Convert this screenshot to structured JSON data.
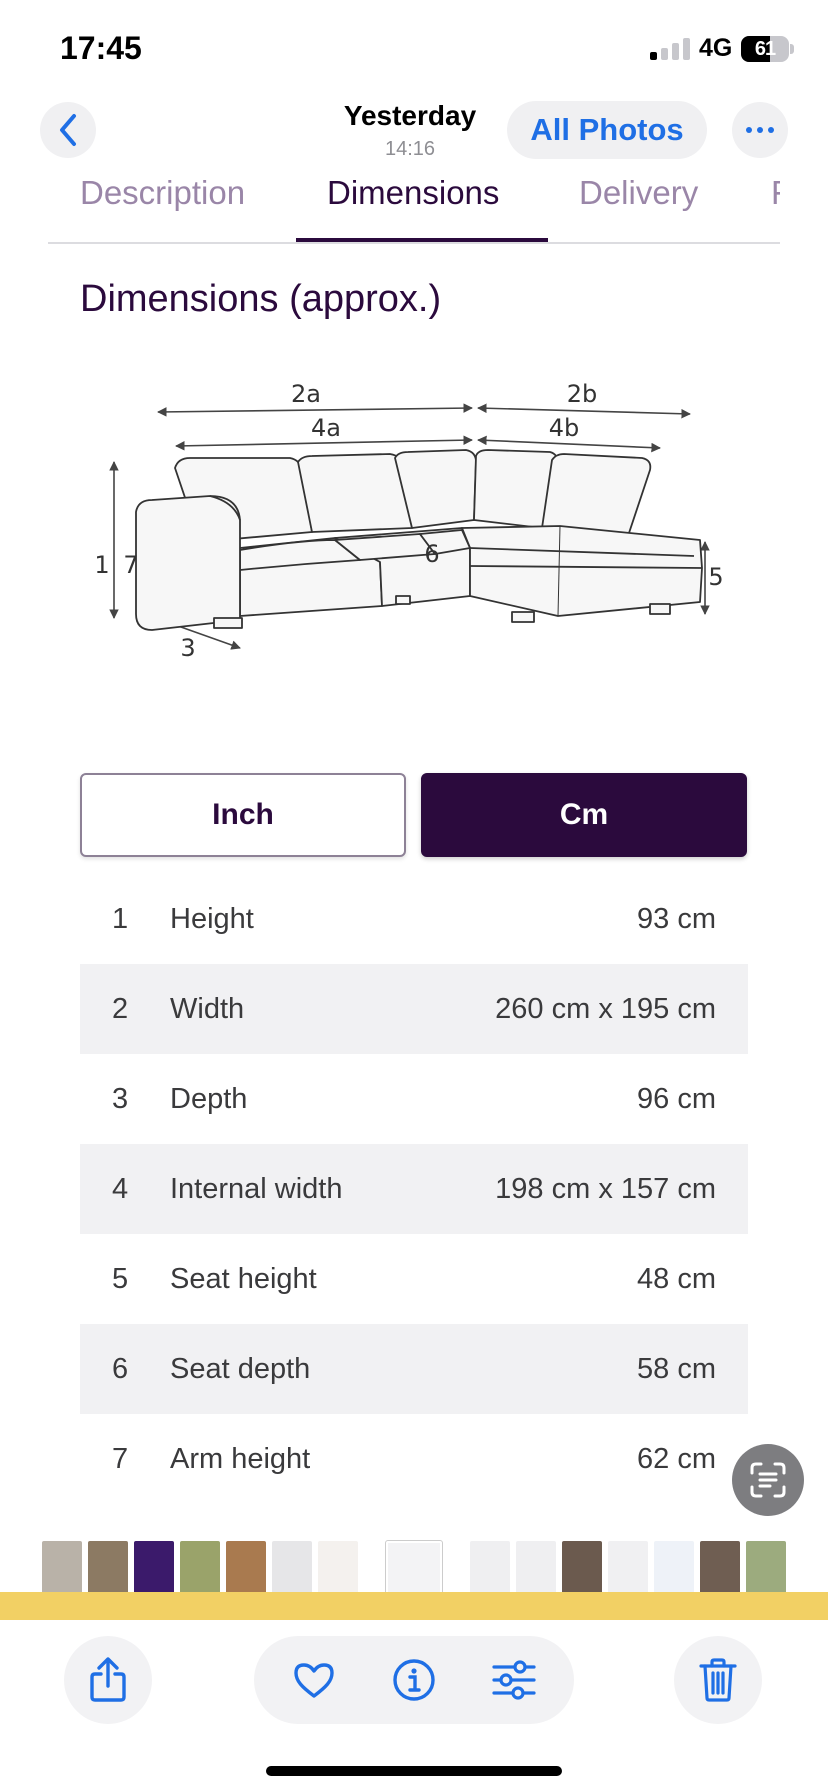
{
  "status_bar": {
    "time": "17:45",
    "network": "4G",
    "battery_level": "61",
    "battery_fraction": 0.61
  },
  "photo_header": {
    "title": "Yesterday",
    "subtitle": "14:16",
    "all_photos_label": "All Photos"
  },
  "page": {
    "tabs": [
      {
        "label": "Description",
        "active": false
      },
      {
        "label": "Dimensions",
        "active": true
      },
      {
        "label": "Delivery",
        "active": false
      },
      {
        "label": "F",
        "active": false
      }
    ],
    "section_title": "Dimensions (approx.)",
    "diagram_labels": [
      "2a",
      "2b",
      "4a",
      "4b",
      "1",
      "7",
      "6",
      "3",
      "5"
    ],
    "unit_toggle": {
      "inch_label": "Inch",
      "cm_label": "Cm",
      "selected": "Cm"
    },
    "dimensions": [
      {
        "num": "1",
        "label": "Height",
        "value": "93 cm"
      },
      {
        "num": "2",
        "label": "Width",
        "value": "260 cm x 195 cm"
      },
      {
        "num": "3",
        "label": "Depth",
        "value": "96 cm"
      },
      {
        "num": "4",
        "label": "Internal width",
        "value": "198 cm x 157 cm"
      },
      {
        "num": "5",
        "label": "Seat height",
        "value": "48 cm"
      },
      {
        "num": "6",
        "label": "Seat depth",
        "value": "58 cm"
      },
      {
        "num": "7",
        "label": "Arm height",
        "value": "62 cm"
      }
    ]
  },
  "icons": {
    "back": "chevron-left-icon",
    "more": "ellipsis-icon",
    "live_text": "live-text-scan-icon",
    "share": "share-icon",
    "favorite": "heart-icon",
    "info": "info-icon",
    "adjust": "sliders-icon",
    "delete": "trash-icon"
  },
  "colors": {
    "accent_blue": "#1f6fe5",
    "brand_purple": "#2b0a3d",
    "tab_inactive": "#9a86a8",
    "highlight_band": "#f2d064"
  }
}
